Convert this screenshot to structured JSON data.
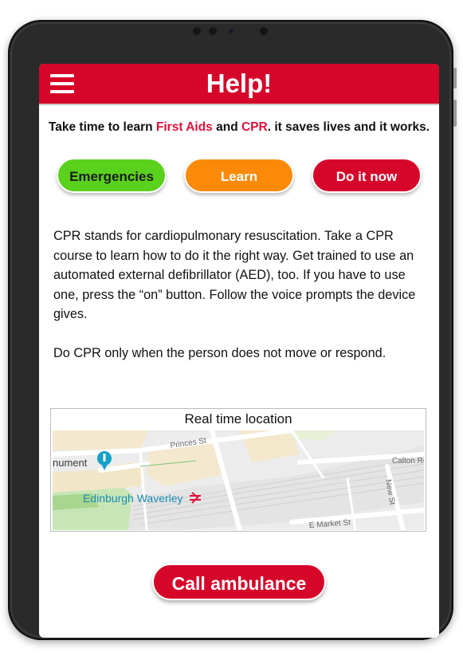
{
  "header": {
    "title": "Help!",
    "menu_icon": "hamburger-menu-icon"
  },
  "tagline": {
    "part1": "Take time to learn ",
    "first_aids": "First Aids",
    "part2": " and ",
    "cpr": "CPR",
    "part3": ". it saves lives and it works."
  },
  "tabs": {
    "emergencies": "Emergencies",
    "learn": "Learn",
    "do_it_now": "Do it now"
  },
  "content": {
    "paragraph1": "CPR stands for cardiopulmonary resuscitation. Take a CPR course to learn how to do it the right way. Get trained to use an automated external defibrillator (AED), too. If you have to use one, press the “on” button. Follow the voice prompts the device gives.",
    "paragraph2": "Do CPR only when the person does not move or respond."
  },
  "map": {
    "title": "Real time location",
    "labels": {
      "princes_st": "Princes St",
      "monument": "nument",
      "edinburgh_waverley": "Edinburgh Waverley",
      "calton_rd": "Calton Ro",
      "new_st": "New St",
      "e_market_st": "E Market St"
    }
  },
  "call_button": "Call ambulance",
  "colors": {
    "brand_red": "#d6062a",
    "emergency_green": "#5ad11c",
    "learn_orange": "#fb8a08",
    "link_red": "#e0103a"
  }
}
